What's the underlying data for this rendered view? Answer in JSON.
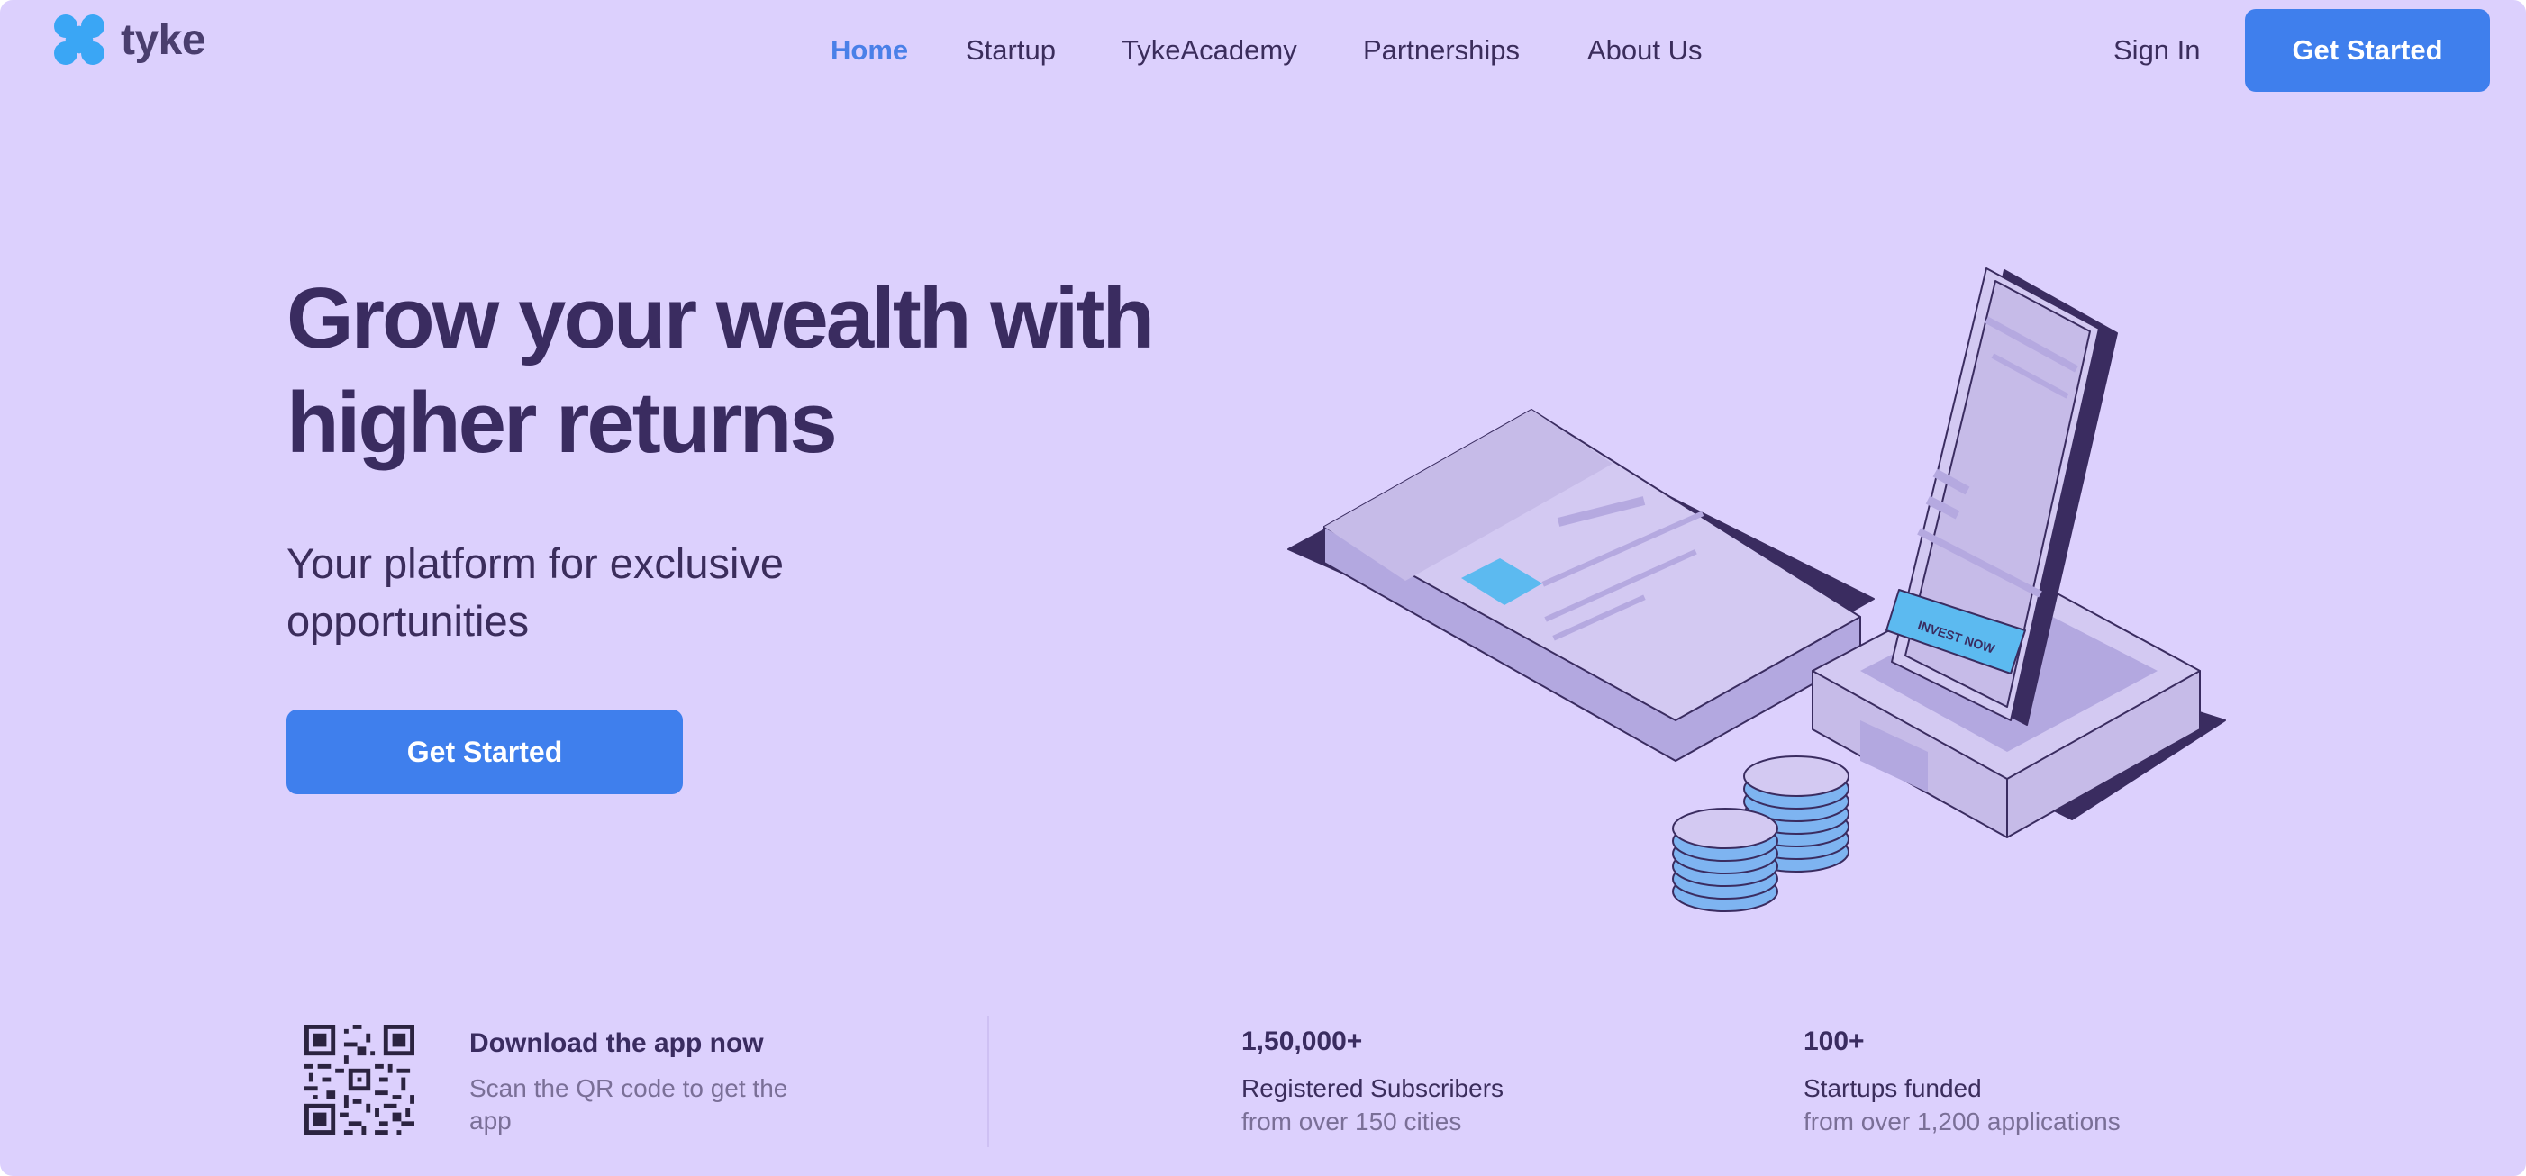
{
  "brand": {
    "name": "tyke",
    "accent": "#3f7fed",
    "background": "#dcd0fd",
    "text": "#3a2c60"
  },
  "nav": {
    "items": [
      {
        "label": "Home",
        "active": true
      },
      {
        "label": "Startup",
        "active": false
      },
      {
        "label": "TykeAcademy",
        "active": false
      },
      {
        "label": "Partnerships",
        "active": false
      },
      {
        "label": "About Us",
        "active": false
      }
    ],
    "sign_in": "Sign In",
    "cta": "Get Started"
  },
  "hero": {
    "title_line1": "Grow your wealth with",
    "title_line2": "higher returns",
    "subtitle": "Your platform for exclusive opportunities",
    "cta": "Get Started",
    "illustration_label": "INVEST NOW"
  },
  "stats": {
    "download": {
      "title": "Download the app now",
      "text": "Scan the QR code to get the app",
      "icon": "qr-code-icon"
    },
    "subscribers": {
      "value": "1,50,000+",
      "label": "Registered Subscribers",
      "detail": "from over 150 cities"
    },
    "startups": {
      "value": "100+",
      "label": "Startups funded",
      "detail": "from over 1,200 applications"
    }
  }
}
